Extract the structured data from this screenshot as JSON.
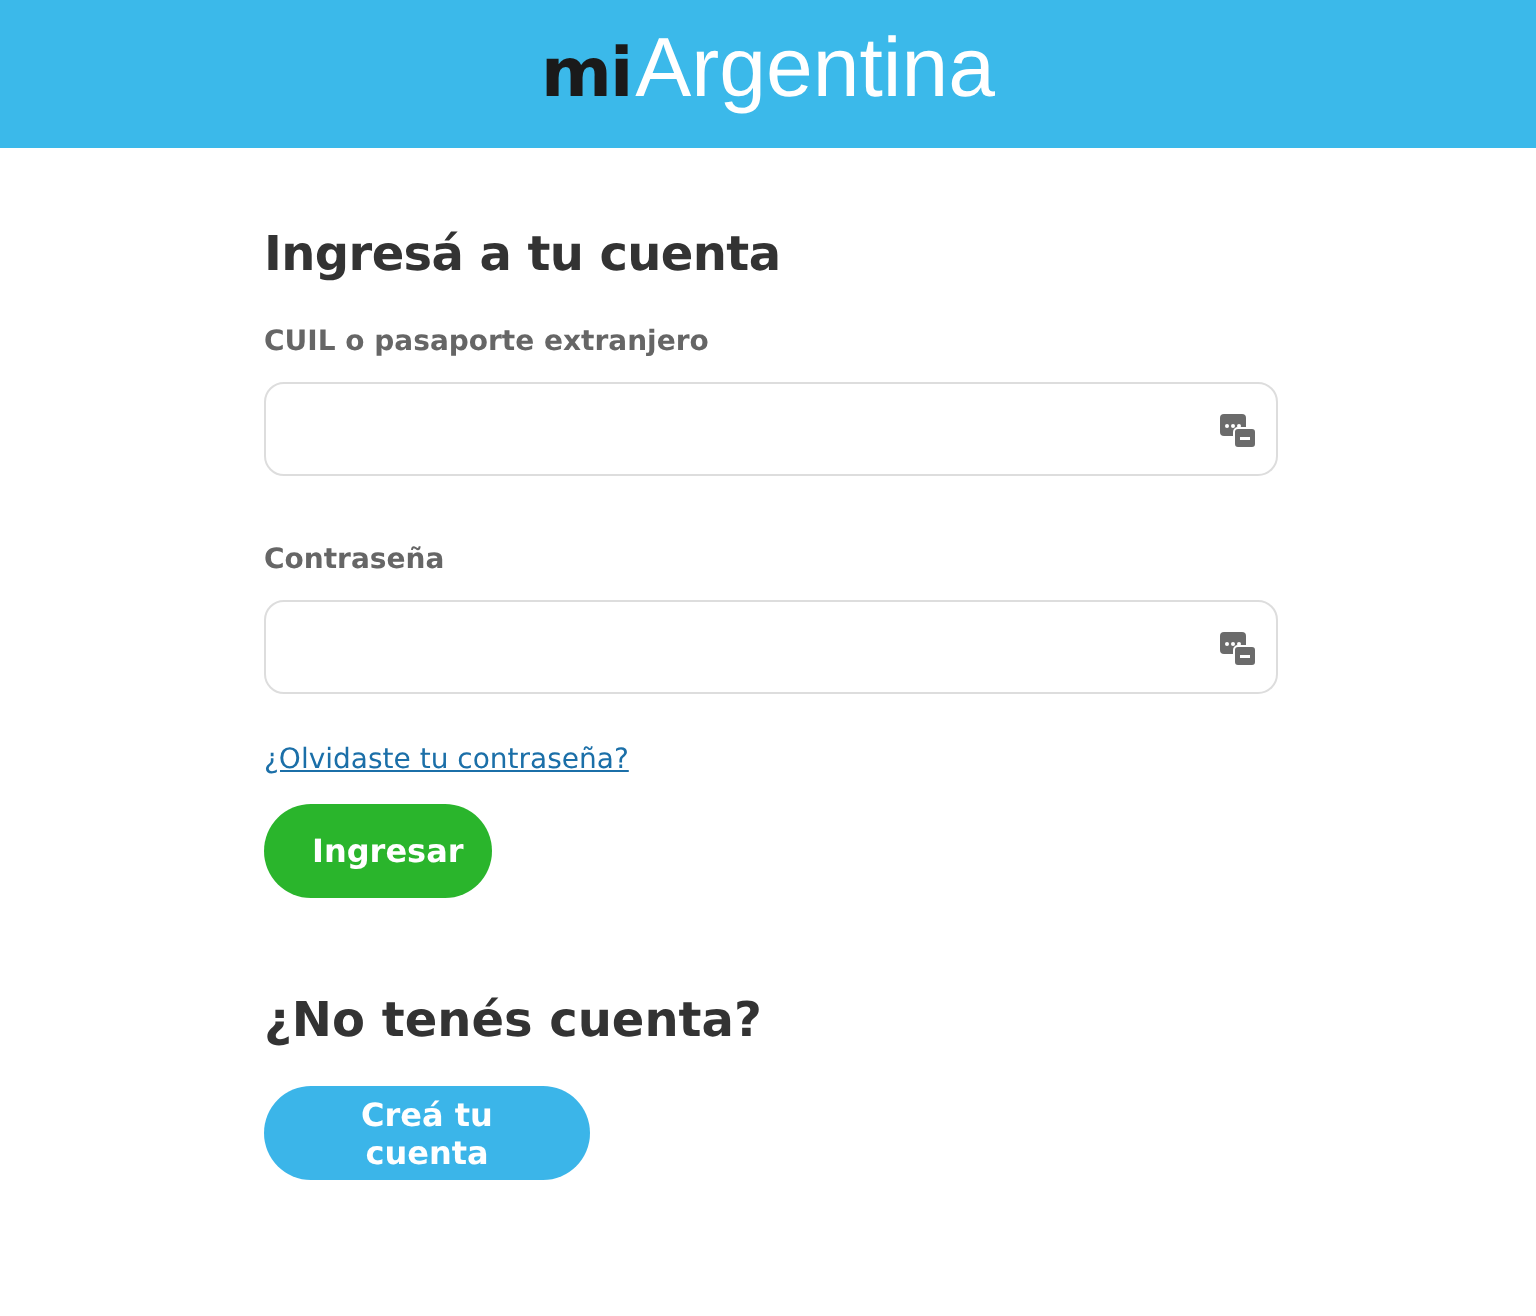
{
  "header": {
    "logo_prefix": "mi",
    "logo_name": "Argentina"
  },
  "login": {
    "title": "Ingresá a tu cuenta",
    "fields": [
      {
        "label": "CUIL o pasaporte extranjero"
      },
      {
        "label": "Contraseña"
      }
    ],
    "forgot_link": "¿Olvidaste tu contraseña?",
    "submit": "Ingresar"
  },
  "signup": {
    "title": "¿No tenés cuenta?",
    "button": "Creá tu cuenta"
  }
}
